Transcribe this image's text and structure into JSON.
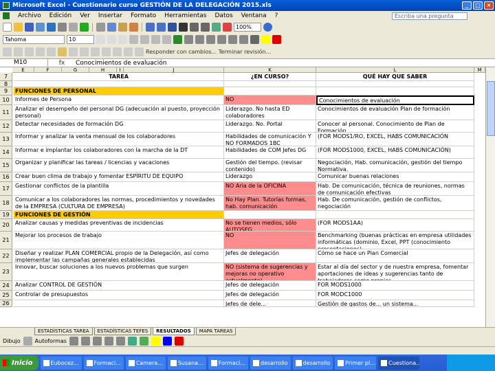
{
  "window": {
    "title": "Microsoft Excel - Cuestionario curso GESTIÓN DE LA DELEGACIÓN 2015.xls"
  },
  "menu": {
    "items": [
      "Archivo",
      "Edición",
      "Ver",
      "Insertar",
      "Formato",
      "Herramientas",
      "Datos",
      "Ventana",
      "?"
    ],
    "help_placeholder": "Escriba una pregunta"
  },
  "toolbar": {
    "zoom": "100%",
    "font": "Tahoma",
    "size": "10",
    "review": "Responder con cambios... Terminar revisión..."
  },
  "formula": {
    "cell": "M10",
    "fx": "fx",
    "value": "Conocimientos de evaluación"
  },
  "columns": [
    "E",
    "F",
    "G",
    "H",
    "I",
    "J",
    "K",
    "L",
    "M"
  ],
  "header_row": {
    "row": "7",
    "tarea": "TAREA",
    "dificultad": "¿EN CURSO?",
    "necesidad": "QUÉ HAY QUE SABER"
  },
  "rows": [
    {
      "row": "8",
      "a": "",
      "b": "",
      "c": ""
    },
    {
      "row": "9",
      "a": "FUNCIONES DE PERSONAL",
      "b": "",
      "c": "",
      "section": true
    },
    {
      "row": "10",
      "a": "Informes de Persona",
      "b": "NO",
      "c": "Conocimientos de evaluación",
      "pink": true,
      "selected": true
    },
    {
      "row": "11",
      "a": "Analizar el desempeño del personal DG (adecuación al puesto, proyección personal)",
      "b": "Liderazgo. No hasta ED colaboradores",
      "c": "Conocimientos de evaluación Plan de formación"
    },
    {
      "row": "12",
      "a": "Detectar necesidades de formación DG",
      "b": "Liderazgo. No. Portal",
      "c": "Conocer al personal. Conocimiento de Plan de Formación"
    },
    {
      "row": "13",
      "a": "Informar y analizar la venta mensual de los colaboradores",
      "b": "Habilidades de comunicación Y NO FORMADOS 1BC",
      "c": "(FOR MODS1/RO, EXCEL, HABS COMUNICACIÓN"
    },
    {
      "row": "14",
      "a": "Informar e implantar los colaboradores con la marcha de la DT",
      "b": "Habilidades de COM Jefes DG",
      "c": "(FOR MODS1000, EXCEL, HABS COMUNICACIÓN)"
    },
    {
      "row": "15",
      "a": "Organizar y planificar las tareas / licencias y vacaciones",
      "b": "Gestión del tiempo. (revisar contenido)",
      "c": "Negociación, Hab. comunicación, gestión del tiempo Normativa."
    },
    {
      "row": "16",
      "a": "Crear buen clima de trabajo y fomentar ESPÍRITU DE EQUIPO",
      "b": "Liderazgo",
      "c": "Comunicar buenas relaciones"
    },
    {
      "row": "17",
      "a": "Gestionar conflictos de la plantilla",
      "b": "NO Aria de la OFICINA",
      "c": "Hab. De comunicación, técnica de reuniones, normas de comunicación efectivas",
      "pink": true
    },
    {
      "row": "18",
      "a": "Comunicar a los colaboradores las normas, procedimientos y novedades de la EMPRESA (CULTURA DE EMPRESA)",
      "b": "No Hay Plan. Tutorías formas, hab. comunicación",
      "c": "Hab. De comunicación, gestión de conflictos, negociación",
      "pink": true
    },
    {
      "row": "19",
      "a": "FUNCIONES DE GESTIÓN",
      "b": "",
      "c": "",
      "section": true
    },
    {
      "row": "20",
      "a": "Analizar causas y medidas preventivas de incidencias",
      "b": "No se tienen medios, sólo AUTOSEG",
      "c": "(FOR MODS1AA)",
      "pink": true
    },
    {
      "row": "21",
      "a": "Mejorar los procesos de trabajo",
      "b": "NO",
      "c": "Benchmarking (buenas prácticas en empresa utilidades informáticas (dominio, Excel, PPT (conocimiento presentaciones)",
      "pink": true
    },
    {
      "row": "22",
      "a": "Diseñar y realizar PLAN COMERCIAL propio de la Delegación, así como implementar las campañas generales establecidas",
      "b": "Jefes de delegación",
      "c": "Cómo se hace un Plan Comercial"
    },
    {
      "row": "23",
      "a": "Innovar, buscar soluciones a los nuevos problemas que surgen",
      "b": "NO (sistema de sugerencias y mejoras no operativo actualmente)",
      "c": "Estar al día del sector y de nuestra empresa, fomentar aportaciones de ideas y sugerencias tanto de trabajadores como propias",
      "pink": true
    },
    {
      "row": "24",
      "a": "Analizar CONTROL DE GESTIÓN",
      "b": "Jefes de delegación",
      "c": "FOR MODS1000"
    },
    {
      "row": "25",
      "a": "Controlar de presupuestos",
      "b": "Jefes de delegación",
      "c": "FOR MODC1000"
    },
    {
      "row": "26",
      "a": "",
      "b": "Jefes de dele...",
      "c": "Gestión de gastos de... un sistema..."
    }
  ],
  "sheets": [
    "ESTADÍSTICAS TAREA",
    "ESTADÍSTICAS TEFES",
    "RESULTADOS",
    "MAPA TAREAS"
  ],
  "active_sheet": "RESULTADOS",
  "drawbar": {
    "dibujo": "Dibujo",
    "autoformas": "Autoformas"
  },
  "taskbar": {
    "start": "Inicio",
    "tasks": [
      "Eubocez...",
      "Formaci...",
      "Camera...",
      "Susana...",
      "Formaci...",
      "desarrollo",
      "desarrollo",
      "Primer pl...",
      "Cuestiona..."
    ]
  }
}
